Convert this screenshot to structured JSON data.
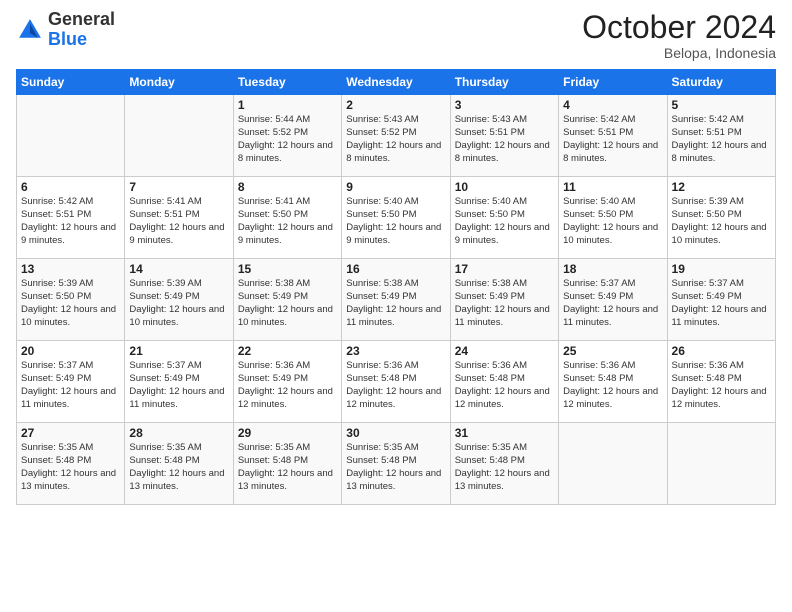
{
  "logo": {
    "general": "General",
    "blue": "Blue"
  },
  "header": {
    "month": "October 2024",
    "location": "Belopa, Indonesia"
  },
  "weekdays": [
    "Sunday",
    "Monday",
    "Tuesday",
    "Wednesday",
    "Thursday",
    "Friday",
    "Saturday"
  ],
  "weeks": [
    [
      {
        "day": "",
        "sunrise": "",
        "sunset": "",
        "daylight": ""
      },
      {
        "day": "",
        "sunrise": "",
        "sunset": "",
        "daylight": ""
      },
      {
        "day": "1",
        "sunrise": "Sunrise: 5:44 AM",
        "sunset": "Sunset: 5:52 PM",
        "daylight": "Daylight: 12 hours and 8 minutes."
      },
      {
        "day": "2",
        "sunrise": "Sunrise: 5:43 AM",
        "sunset": "Sunset: 5:52 PM",
        "daylight": "Daylight: 12 hours and 8 minutes."
      },
      {
        "day": "3",
        "sunrise": "Sunrise: 5:43 AM",
        "sunset": "Sunset: 5:51 PM",
        "daylight": "Daylight: 12 hours and 8 minutes."
      },
      {
        "day": "4",
        "sunrise": "Sunrise: 5:42 AM",
        "sunset": "Sunset: 5:51 PM",
        "daylight": "Daylight: 12 hours and 8 minutes."
      },
      {
        "day": "5",
        "sunrise": "Sunrise: 5:42 AM",
        "sunset": "Sunset: 5:51 PM",
        "daylight": "Daylight: 12 hours and 8 minutes."
      }
    ],
    [
      {
        "day": "6",
        "sunrise": "Sunrise: 5:42 AM",
        "sunset": "Sunset: 5:51 PM",
        "daylight": "Daylight: 12 hours and 9 minutes."
      },
      {
        "day": "7",
        "sunrise": "Sunrise: 5:41 AM",
        "sunset": "Sunset: 5:51 PM",
        "daylight": "Daylight: 12 hours and 9 minutes."
      },
      {
        "day": "8",
        "sunrise": "Sunrise: 5:41 AM",
        "sunset": "Sunset: 5:50 PM",
        "daylight": "Daylight: 12 hours and 9 minutes."
      },
      {
        "day": "9",
        "sunrise": "Sunrise: 5:40 AM",
        "sunset": "Sunset: 5:50 PM",
        "daylight": "Daylight: 12 hours and 9 minutes."
      },
      {
        "day": "10",
        "sunrise": "Sunrise: 5:40 AM",
        "sunset": "Sunset: 5:50 PM",
        "daylight": "Daylight: 12 hours and 9 minutes."
      },
      {
        "day": "11",
        "sunrise": "Sunrise: 5:40 AM",
        "sunset": "Sunset: 5:50 PM",
        "daylight": "Daylight: 12 hours and 10 minutes."
      },
      {
        "day": "12",
        "sunrise": "Sunrise: 5:39 AM",
        "sunset": "Sunset: 5:50 PM",
        "daylight": "Daylight: 12 hours and 10 minutes."
      }
    ],
    [
      {
        "day": "13",
        "sunrise": "Sunrise: 5:39 AM",
        "sunset": "Sunset: 5:50 PM",
        "daylight": "Daylight: 12 hours and 10 minutes."
      },
      {
        "day": "14",
        "sunrise": "Sunrise: 5:39 AM",
        "sunset": "Sunset: 5:49 PM",
        "daylight": "Daylight: 12 hours and 10 minutes."
      },
      {
        "day": "15",
        "sunrise": "Sunrise: 5:38 AM",
        "sunset": "Sunset: 5:49 PM",
        "daylight": "Daylight: 12 hours and 10 minutes."
      },
      {
        "day": "16",
        "sunrise": "Sunrise: 5:38 AM",
        "sunset": "Sunset: 5:49 PM",
        "daylight": "Daylight: 12 hours and 11 minutes."
      },
      {
        "day": "17",
        "sunrise": "Sunrise: 5:38 AM",
        "sunset": "Sunset: 5:49 PM",
        "daylight": "Daylight: 12 hours and 11 minutes."
      },
      {
        "day": "18",
        "sunrise": "Sunrise: 5:37 AM",
        "sunset": "Sunset: 5:49 PM",
        "daylight": "Daylight: 12 hours and 11 minutes."
      },
      {
        "day": "19",
        "sunrise": "Sunrise: 5:37 AM",
        "sunset": "Sunset: 5:49 PM",
        "daylight": "Daylight: 12 hours and 11 minutes."
      }
    ],
    [
      {
        "day": "20",
        "sunrise": "Sunrise: 5:37 AM",
        "sunset": "Sunset: 5:49 PM",
        "daylight": "Daylight: 12 hours and 11 minutes."
      },
      {
        "day": "21",
        "sunrise": "Sunrise: 5:37 AM",
        "sunset": "Sunset: 5:49 PM",
        "daylight": "Daylight: 12 hours and 11 minutes."
      },
      {
        "day": "22",
        "sunrise": "Sunrise: 5:36 AM",
        "sunset": "Sunset: 5:49 PM",
        "daylight": "Daylight: 12 hours and 12 minutes."
      },
      {
        "day": "23",
        "sunrise": "Sunrise: 5:36 AM",
        "sunset": "Sunset: 5:48 PM",
        "daylight": "Daylight: 12 hours and 12 minutes."
      },
      {
        "day": "24",
        "sunrise": "Sunrise: 5:36 AM",
        "sunset": "Sunset: 5:48 PM",
        "daylight": "Daylight: 12 hours and 12 minutes."
      },
      {
        "day": "25",
        "sunrise": "Sunrise: 5:36 AM",
        "sunset": "Sunset: 5:48 PM",
        "daylight": "Daylight: 12 hours and 12 minutes."
      },
      {
        "day": "26",
        "sunrise": "Sunrise: 5:36 AM",
        "sunset": "Sunset: 5:48 PM",
        "daylight": "Daylight: 12 hours and 12 minutes."
      }
    ],
    [
      {
        "day": "27",
        "sunrise": "Sunrise: 5:35 AM",
        "sunset": "Sunset: 5:48 PM",
        "daylight": "Daylight: 12 hours and 13 minutes."
      },
      {
        "day": "28",
        "sunrise": "Sunrise: 5:35 AM",
        "sunset": "Sunset: 5:48 PM",
        "daylight": "Daylight: 12 hours and 13 minutes."
      },
      {
        "day": "29",
        "sunrise": "Sunrise: 5:35 AM",
        "sunset": "Sunset: 5:48 PM",
        "daylight": "Daylight: 12 hours and 13 minutes."
      },
      {
        "day": "30",
        "sunrise": "Sunrise: 5:35 AM",
        "sunset": "Sunset: 5:48 PM",
        "daylight": "Daylight: 12 hours and 13 minutes."
      },
      {
        "day": "31",
        "sunrise": "Sunrise: 5:35 AM",
        "sunset": "Sunset: 5:48 PM",
        "daylight": "Daylight: 12 hours and 13 minutes."
      },
      {
        "day": "",
        "sunrise": "",
        "sunset": "",
        "daylight": ""
      },
      {
        "day": "",
        "sunrise": "",
        "sunset": "",
        "daylight": ""
      }
    ]
  ]
}
